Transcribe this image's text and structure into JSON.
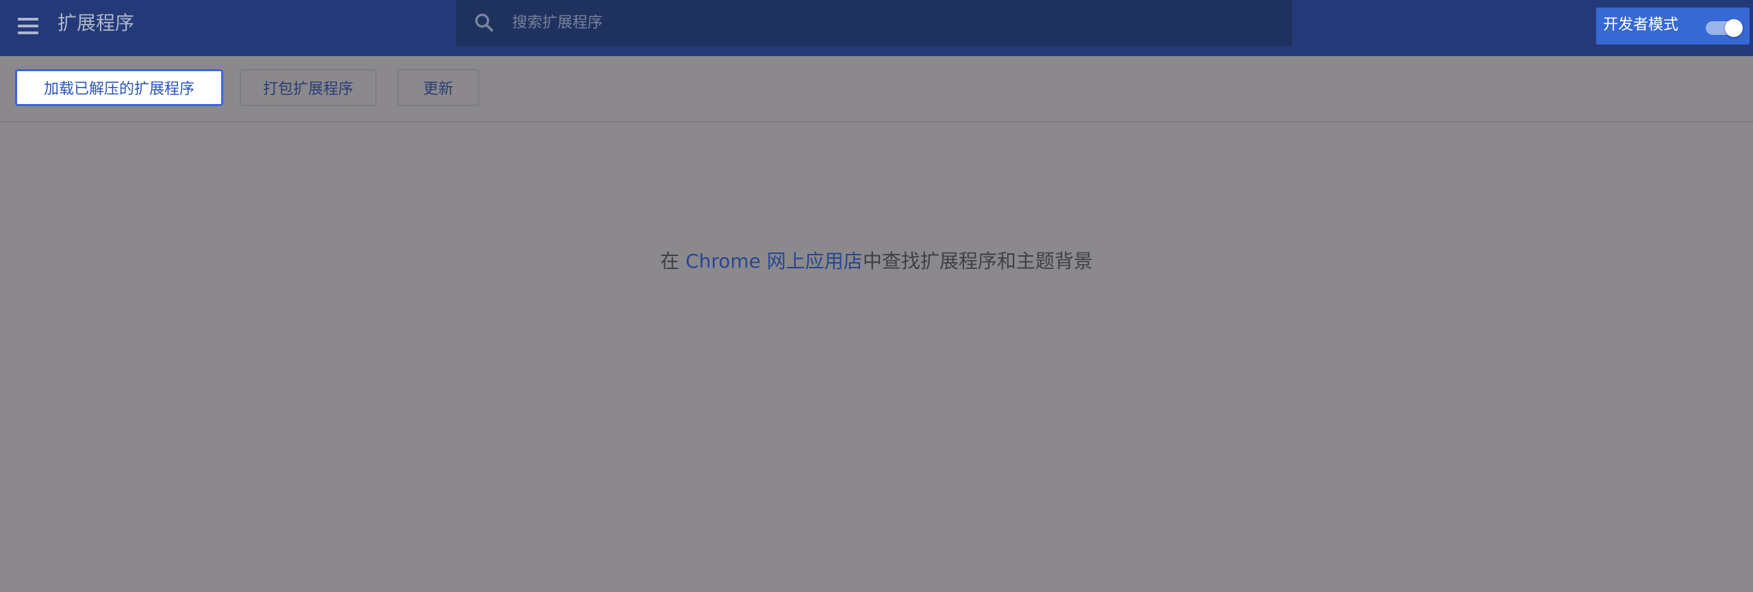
{
  "header": {
    "title": "扩展程序",
    "menu_icon": "hamburger-menu-icon",
    "search": {
      "placeholder": "搜索扩展程序",
      "value": "",
      "icon": "search-icon"
    },
    "developer_mode": {
      "label": "开发者模式",
      "enabled": true
    }
  },
  "toolbar": {
    "load_unpacked_label": "加载已解压的扩展程序",
    "pack_label": "打包扩展程序",
    "update_label": "更新"
  },
  "empty_state": {
    "prefix": "在 ",
    "link_text": "Chrome 网上应用店",
    "suffix": "中查找扩展程序和主题背景"
  },
  "colors": {
    "header_bg": "#243a78",
    "search_bg": "#1f325f",
    "accent": "#3669d4",
    "page_bg": "#8b898c",
    "link": "#284592"
  }
}
